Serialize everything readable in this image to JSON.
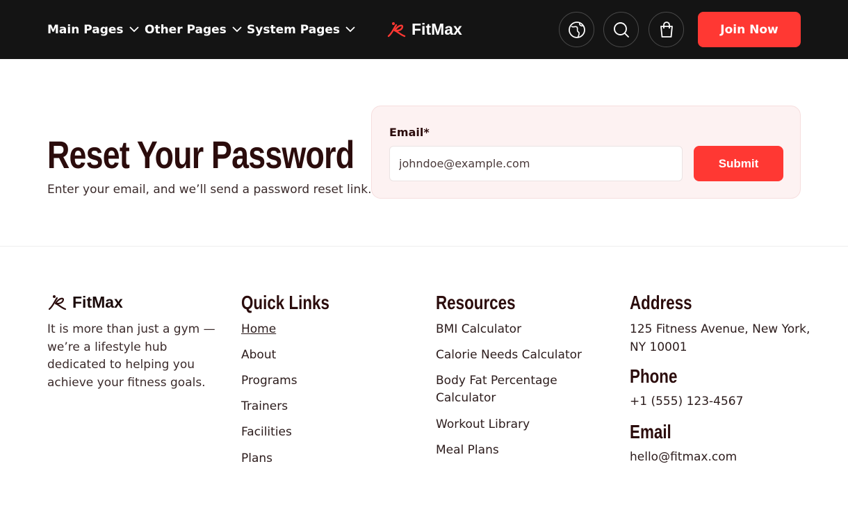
{
  "header": {
    "nav": [
      {
        "label": "Main Pages"
      },
      {
        "label": "Other Pages"
      },
      {
        "label": "System Pages"
      }
    ],
    "brand": "FitMax",
    "icons": [
      "globe-icon",
      "search-icon",
      "shopping-bag-icon"
    ],
    "cta_label": "Join Now"
  },
  "hero": {
    "title": "Reset Your Password",
    "subtitle": "Enter your email, and we’ll send a password reset link."
  },
  "form": {
    "email_label": "Email*",
    "email_placeholder": "johndoe@example.com",
    "submit_label": "Submit"
  },
  "footer": {
    "brand": "FitMax",
    "description": "It is more than just a gym — we’re a lifestyle hub dedicated to helping you achieve your fitness goals.",
    "quick_links": {
      "title": "Quick Links",
      "items": [
        "Home",
        "About",
        "Programs",
        "Trainers",
        "Facilities",
        "Plans"
      ]
    },
    "resources": {
      "title": "Resources",
      "items": [
        "BMI Calculator",
        "Calorie Needs Calculator",
        "Body Fat Percentage Calculator",
        "Workout Library",
        "Meal Plans"
      ]
    },
    "address": {
      "title": "Address",
      "value": "125 Fitness Avenue, New York, NY 10001"
    },
    "phone": {
      "title": "Phone",
      "value": "+1 (555) 123-4567"
    },
    "email": {
      "title": "Email",
      "value": "hello@fitmax.com"
    }
  },
  "colors": {
    "accent": "#ff3833",
    "header_bg": "#141414",
    "heading": "#2b0c0c",
    "card_bg": "#fdf2f2"
  }
}
